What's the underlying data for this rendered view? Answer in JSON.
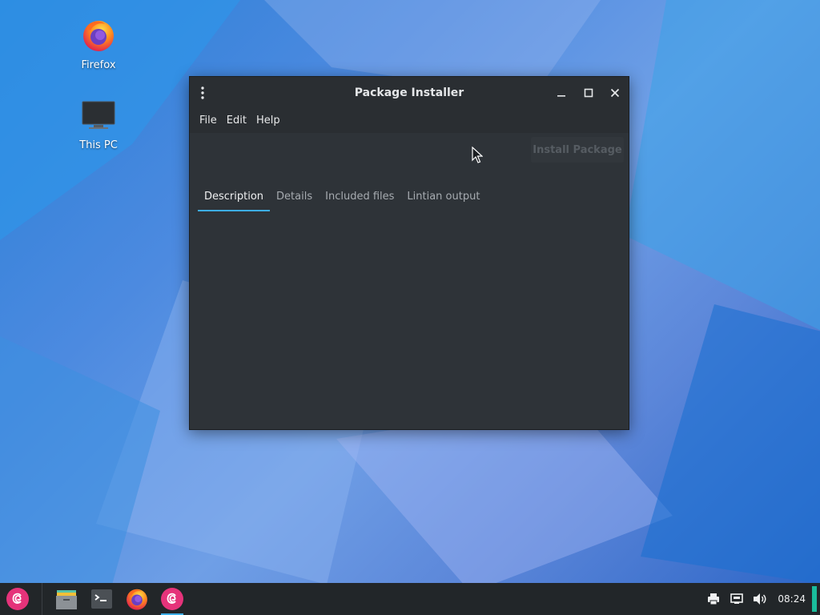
{
  "desktop": {
    "icons": [
      {
        "label": "Firefox",
        "icon": "firefox-icon"
      },
      {
        "label": "This PC",
        "icon": "monitor-icon"
      }
    ]
  },
  "window": {
    "title": "Package Installer",
    "menu": [
      "File",
      "Edit",
      "Help"
    ],
    "install_button": "Install Package",
    "tabs": [
      {
        "label": "Description",
        "active": true
      },
      {
        "label": "Details",
        "active": false
      },
      {
        "label": "Included files",
        "active": false
      },
      {
        "label": "Lintian output",
        "active": false
      }
    ]
  },
  "taskbar": {
    "apps": [
      "debian-menu-icon",
      "file-manager-icon",
      "terminal-icon",
      "firefox-icon",
      "debian-installer-icon"
    ],
    "tray": [
      "printer-icon",
      "network-icon",
      "volume-icon"
    ],
    "clock": "08:24",
    "accent": "#3daee9"
  }
}
